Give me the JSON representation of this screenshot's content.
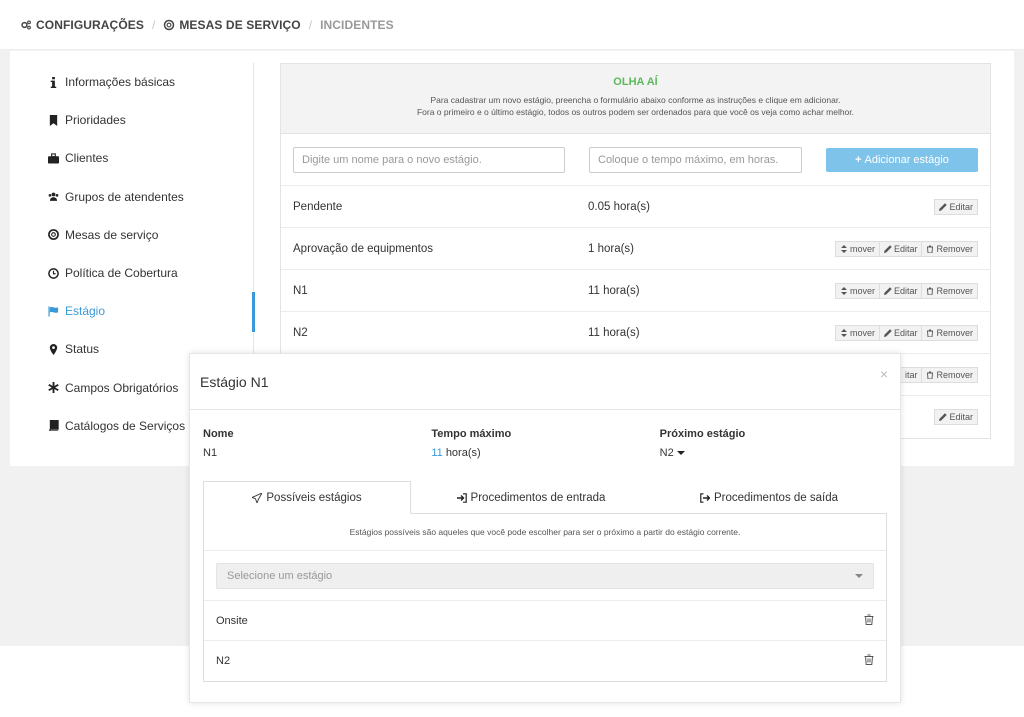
{
  "breadcrumb": [
    {
      "label": "CONFIGURAÇÕES",
      "icon": "cogs-icon"
    },
    {
      "label": "MESAS DE SERVIÇO",
      "icon": "life-ring-icon"
    },
    {
      "label": "INCIDENTES",
      "icon": ""
    }
  ],
  "sidebar": {
    "items": [
      {
        "label": "Informações básicas",
        "icon": "info-icon"
      },
      {
        "label": "Prioridades",
        "icon": "bookmark-icon"
      },
      {
        "label": "Clientes",
        "icon": "briefcase-icon"
      },
      {
        "label": "Grupos de atendentes",
        "icon": "users-icon"
      },
      {
        "label": "Mesas de serviço",
        "icon": "life-ring-icon"
      },
      {
        "label": "Política de Cobertura",
        "icon": "clock-icon"
      },
      {
        "label": "Estágio",
        "icon": "flag-icon",
        "active": true
      },
      {
        "label": "Status",
        "icon": "map-marker-icon"
      },
      {
        "label": "Campos Obrigatórios",
        "icon": "asterisk-icon"
      },
      {
        "label": "Catálogos de Serviços",
        "icon": "book-icon"
      }
    ]
  },
  "info": {
    "title": "OLHA AÍ",
    "line1": "Para cadastrar um novo estágio, preencha o formulário abaixo conforme as instruções e clique em adicionar.",
    "line2": "Fora o primeiro e o último estágio, todos os outros podem ser ordenados para que você os veja como achar melhor."
  },
  "form": {
    "name_placeholder": "Digite um nome para o novo estágio.",
    "time_placeholder": "Coloque o tempo máximo, em horas.",
    "add_label": "Adicionar estágio"
  },
  "actions": {
    "move": "mover",
    "edit": "Editar",
    "remove": "Remover"
  },
  "stages": [
    {
      "name": "Pendente",
      "time": "0.05 hora(s)",
      "move": false,
      "remove": false
    },
    {
      "name": "Aprovação de equipmentos",
      "time": "1 hora(s)",
      "move": true,
      "remove": true
    },
    {
      "name": "N1",
      "time": "11 hora(s)",
      "move": true,
      "remove": true
    },
    {
      "name": "N2",
      "time": "11 hora(s)",
      "move": true,
      "remove": true
    },
    {
      "name": "",
      "time": "",
      "move": false,
      "remove": true,
      "partial_edit": "itar"
    },
    {
      "name": "",
      "time": "",
      "move": false,
      "remove": false
    }
  ],
  "modal": {
    "title": "Estágio N1",
    "close": "×",
    "name_label": "Nome",
    "name_value": "N1",
    "time_label": "Tempo máximo",
    "time_value": "11",
    "time_unit": "hora(s)",
    "next_label": "Próximo estágio",
    "next_value": "N2",
    "tabs": [
      {
        "label": "Possíveis estágios",
        "icon": "paper-plane-icon"
      },
      {
        "label": "Procedimentos de entrada",
        "icon": "sign-in-icon"
      },
      {
        "label": "Procedimentos de saída",
        "icon": "sign-out-icon"
      }
    ],
    "panel_note": "Estágios possíveis são aqueles que você pode escolher para ser o próximo a partir do estágio corrente.",
    "select_placeholder": "Selecione um estágio",
    "possible": [
      "Onsite",
      "N2"
    ]
  }
}
